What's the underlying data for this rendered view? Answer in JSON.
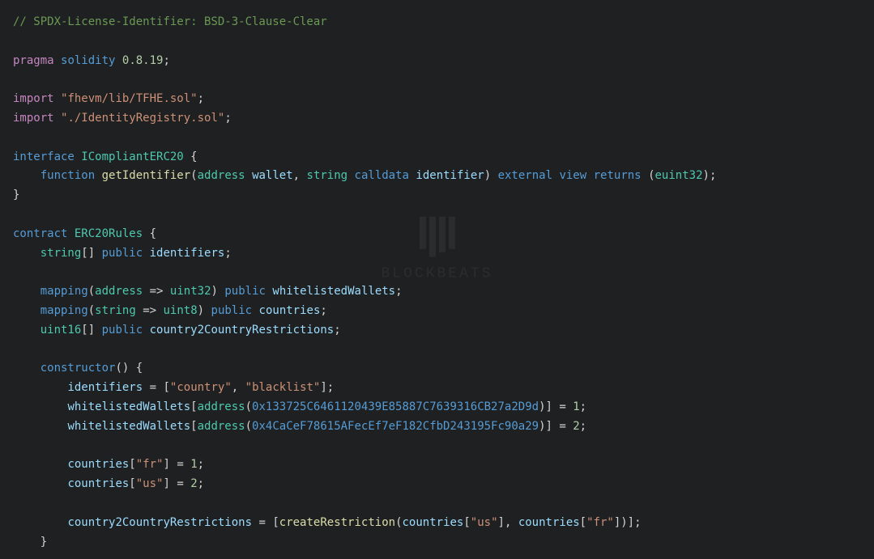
{
  "code": {
    "license_comment": "// SPDX-License-Identifier: BSD-3-Clause-Clear",
    "pragma_keyword": "pragma",
    "solidity_keyword": "solidity",
    "version": "0.8.19",
    "import_keyword": "import",
    "import1": "\"fhevm/lib/TFHE.sol\"",
    "import2": "\"./IdentityRegistry.sol\"",
    "interface_keyword": "interface",
    "interface_name": "ICompliantERC20",
    "function_keyword": "function",
    "getIdentifier_name": "getIdentifier",
    "address_type": "address",
    "wallet_param": "wallet",
    "string_type": "string",
    "calldata_keyword": "calldata",
    "identifier_param": "identifier",
    "external_keyword": "external",
    "view_keyword": "view",
    "returns_keyword": "returns",
    "euint32_type": "euint32",
    "contract_keyword": "contract",
    "contract_name": "ERC20Rules",
    "public_keyword": "public",
    "identifiers_var": "identifiers",
    "mapping_keyword": "mapping",
    "uint32_type": "uint32",
    "whitelistedWallets_var": "whitelistedWallets",
    "uint8_type": "uint8",
    "countries_var": "countries",
    "uint16_type": "uint16",
    "country2CountryRestrictions_var": "country2CountryRestrictions",
    "constructor_keyword": "constructor",
    "country_str": "\"country\"",
    "blacklist_str": "\"blacklist\"",
    "address1": "0x133725C6461120439E85887C7639316CB27a2D9d",
    "address2": "0x4CaCeF78615AFecEf7eF182CfbD243195Fc90a29",
    "num1": "1",
    "num2": "2",
    "fr_str": "\"fr\"",
    "us_str": "\"us\"",
    "createRestriction_fn": "createRestriction"
  },
  "watermark": {
    "text": "BLOCKBEATS"
  }
}
